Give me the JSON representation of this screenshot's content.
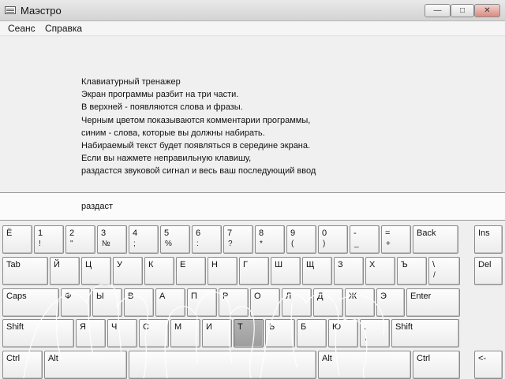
{
  "window": {
    "title": "Маэстро"
  },
  "menu": [
    "Сеанс",
    "Справка"
  ],
  "info_lines": [
    "Клавиатурный тренажер",
    "Экран программы разбит на три части.",
    "В верхней - появляются слова и фразы.",
    "Черным цветом показываются комментарии программы,",
    "синим - слова, которые вы должны набирать.",
    "Набираемый текст будет появляться в середине экрана.",
    "Если вы нажмете неправильную клавишу,",
    "раздастся звуковой сигнал и весь ваш последующий ввод"
  ],
  "typed_text": "раздаст",
  "keyboard": {
    "rows": [
      [
        {
          "l": "Ё",
          "s": ""
        },
        {
          "l": "1",
          "s": "!"
        },
        {
          "l": "2",
          "s": "\""
        },
        {
          "l": "3",
          "s": "№"
        },
        {
          "l": "4",
          "s": ";"
        },
        {
          "l": "5",
          "s": "%"
        },
        {
          "l": "6",
          "s": ":"
        },
        {
          "l": "7",
          "s": "?"
        },
        {
          "l": "8",
          "s": "*"
        },
        {
          "l": "9",
          "s": "("
        },
        {
          "l": "0",
          "s": ")"
        },
        {
          "l": "-",
          "s": "_"
        },
        {
          "l": "=",
          "s": "+"
        },
        {
          "l": "Back",
          "s": ""
        },
        {
          "l": "Ins",
          "s": ""
        }
      ],
      [
        {
          "l": "Tab",
          "s": ""
        },
        {
          "l": "Й",
          "s": ""
        },
        {
          "l": "Ц",
          "s": ""
        },
        {
          "l": "У",
          "s": ""
        },
        {
          "l": "К",
          "s": ""
        },
        {
          "l": "Е",
          "s": ""
        },
        {
          "l": "Н",
          "s": ""
        },
        {
          "l": "Г",
          "s": ""
        },
        {
          "l": "Ш",
          "s": ""
        },
        {
          "l": "Щ",
          "s": ""
        },
        {
          "l": "З",
          "s": ""
        },
        {
          "l": "Х",
          "s": ""
        },
        {
          "l": "Ъ",
          "s": ""
        },
        {
          "l": "\\",
          "s": "/"
        },
        {
          "l": "Del",
          "s": ""
        }
      ],
      [
        {
          "l": "Caps",
          "s": ""
        },
        {
          "l": "Ф",
          "s": ""
        },
        {
          "l": "Ы",
          "s": ""
        },
        {
          "l": "В",
          "s": ""
        },
        {
          "l": "А",
          "s": ""
        },
        {
          "l": "П",
          "s": ""
        },
        {
          "l": "Р",
          "s": ""
        },
        {
          "l": "О",
          "s": ""
        },
        {
          "l": "Л",
          "s": ""
        },
        {
          "l": "Д",
          "s": ""
        },
        {
          "l": "Ж",
          "s": ""
        },
        {
          "l": "Э",
          "s": ""
        },
        {
          "l": "Enter",
          "s": ""
        }
      ],
      [
        {
          "l": "Shift",
          "s": ""
        },
        {
          "l": "Я",
          "s": ""
        },
        {
          "l": "Ч",
          "s": ""
        },
        {
          "l": "С",
          "s": ""
        },
        {
          "l": "М",
          "s": ""
        },
        {
          "l": "И",
          "s": ""
        },
        {
          "l": "Т",
          "s": "",
          "hl": true
        },
        {
          "l": "Ь",
          "s": ""
        },
        {
          "l": "Б",
          "s": ""
        },
        {
          "l": "Ю",
          "s": ""
        },
        {
          "l": ".",
          "s": ","
        },
        {
          "l": "Shift",
          "s": ""
        }
      ],
      [
        {
          "l": "Ctrl",
          "s": ""
        },
        {
          "l": "Alt",
          "s": ""
        },
        {
          "l": "",
          "s": ""
        },
        {
          "l": "Alt",
          "s": ""
        },
        {
          "l": "Ctrl",
          "s": ""
        },
        {
          "l": "<-",
          "s": ""
        }
      ]
    ]
  }
}
